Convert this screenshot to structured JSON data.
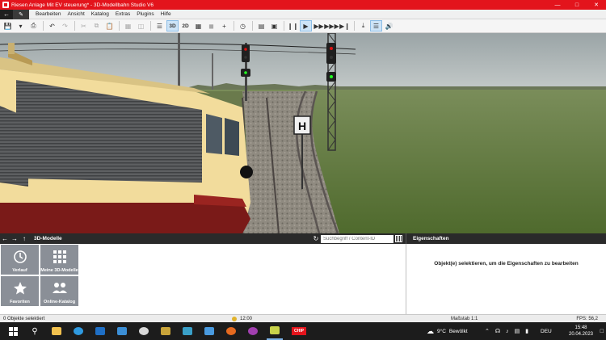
{
  "window": {
    "title": "Riesen Anlage Mit EV steuerung* - 3D-Modellbahn Studio V6",
    "minimize_icon": "minimize-icon",
    "maximize_icon": "maximize-icon",
    "close_icon": "close-icon"
  },
  "menubar": {
    "items": [
      "Bearbeiten",
      "Ansicht",
      "Katalog",
      "Extras",
      "Plugins",
      "Hilfe"
    ]
  },
  "toolbar": {
    "view_3d": "3D",
    "view_2d": "2D"
  },
  "viewport": {
    "sign_letter": "H"
  },
  "library": {
    "title": "3D-Modelle",
    "search_placeholder": "Suchbegriff / Content-ID",
    "tiles": [
      "Verlauf",
      "Meine 3D-Modelle",
      "Favoriten",
      "Online-Katalog"
    ]
  },
  "properties": {
    "title": "Eigenschaften",
    "hint": "Objekt(e) selektieren, um die Eigenschaften zu bearbeiten"
  },
  "status": {
    "selection": "0 Objekte selektiert",
    "time": "12:00",
    "scale": "Maßstab 1:1",
    "fps": "FPS: 56,2"
  },
  "taskbar": {
    "weather_temp": "9°C",
    "weather_text": "Bewölkt",
    "language": "DEU",
    "time": "15:48",
    "date": "20.04.2023",
    "app_label": "CHIP"
  },
  "colors": {
    "title_bar": "#e3141c",
    "panel_header": "#2a2a2a",
    "tile": "#8a8f97",
    "sky": "#aeb6b7",
    "grass": "#607a3c",
    "loco_body": "#f2dc9c",
    "loco_stripe": "#7a1a18"
  }
}
